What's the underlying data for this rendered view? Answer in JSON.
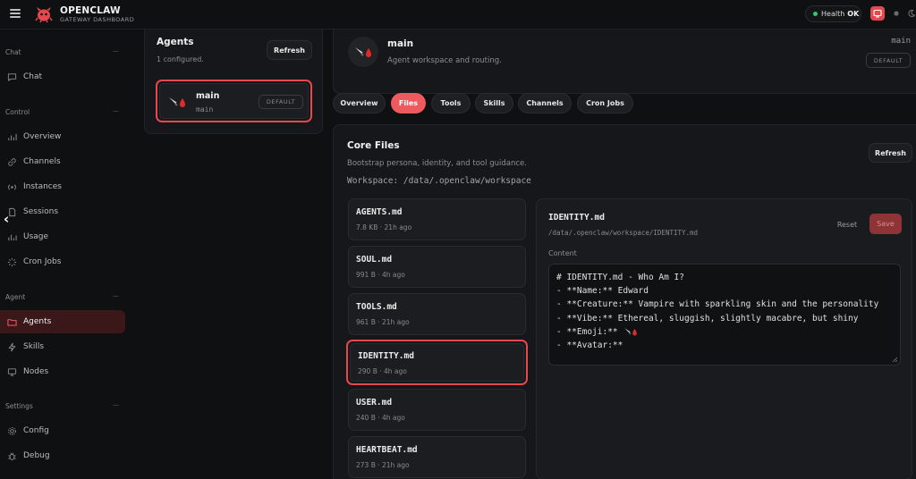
{
  "brand": {
    "name": "OPENCLAW",
    "subtitle": "GATEWAY DASHBOARD"
  },
  "health": {
    "label": "Health",
    "status": "OK",
    "status_color": "#2ecc71"
  },
  "accent": "#e5484d",
  "sidebar": {
    "sections": [
      {
        "title": "Chat",
        "items": [
          {
            "label": "Chat",
            "icon": "chat-bubble-icon"
          }
        ]
      },
      {
        "title": "Control",
        "items": [
          {
            "label": "Overview",
            "icon": "bar-chart-icon"
          },
          {
            "label": "Channels",
            "icon": "link-icon"
          },
          {
            "label": "Instances",
            "icon": "radio-icon"
          },
          {
            "label": "Sessions",
            "icon": "document-icon"
          },
          {
            "label": "Usage",
            "icon": "bar-chart-icon"
          },
          {
            "label": "Cron Jobs",
            "icon": "loader-icon"
          }
        ]
      },
      {
        "title": "Agent",
        "items": [
          {
            "label": "Agents",
            "icon": "folder-icon",
            "active": true
          },
          {
            "label": "Skills",
            "icon": "bolt-icon"
          },
          {
            "label": "Nodes",
            "icon": "monitor-icon"
          }
        ]
      },
      {
        "title": "Settings",
        "items": [
          {
            "label": "Config",
            "icon": "gear-icon"
          },
          {
            "label": "Debug",
            "icon": "bug-icon"
          }
        ]
      }
    ]
  },
  "agents_panel": {
    "title": "Agents",
    "subtitle": "1 configured.",
    "refresh_label": "Refresh",
    "agents": [
      {
        "name": "main",
        "id": "main",
        "badge": "DEFAULT"
      }
    ]
  },
  "agent_header": {
    "name": "main",
    "subtitle": "Agent workspace and routing.",
    "id": "main",
    "badge": "DEFAULT"
  },
  "tabs": [
    {
      "label": "Overview"
    },
    {
      "label": "Files",
      "active": true
    },
    {
      "label": "Tools"
    },
    {
      "label": "Skills"
    },
    {
      "label": "Channels"
    },
    {
      "label": "Cron Jobs"
    }
  ],
  "core_files": {
    "title": "Core Files",
    "subtitle": "Bootstrap persona, identity, and tool guidance.",
    "workspace": "Workspace: /data/.openclaw/workspace",
    "refresh_label": "Refresh",
    "files": [
      {
        "name": "AGENTS.md",
        "meta": "7.8 KB · 21h ago"
      },
      {
        "name": "SOUL.md",
        "meta": "991 B · 4h ago"
      },
      {
        "name": "TOOLS.md",
        "meta": "961 B · 21h ago"
      },
      {
        "name": "IDENTITY.md",
        "meta": "290 B · 4h ago",
        "selected": true
      },
      {
        "name": "USER.md",
        "meta": "240 B · 4h ago"
      },
      {
        "name": "HEARTBEAT.md",
        "meta": "273 B · 21h ago"
      }
    ]
  },
  "editor": {
    "title": "IDENTITY.md",
    "path": "/data/.openclaw/workspace/IDENTITY.md",
    "reset_label": "Reset",
    "save_label": "Save",
    "content_label": "Content",
    "lines": [
      "# IDENTITY.md - Who Am I?",
      "",
      "- **Name:** Edward",
      "- **Creature:** Vampire with sparkling skin and the personality",
      "- **Vibe:** Ethereal, sluggish, slightly macabre, but shiny",
      "- **Emoji:** ",
      "- **Avatar:**"
    ]
  }
}
